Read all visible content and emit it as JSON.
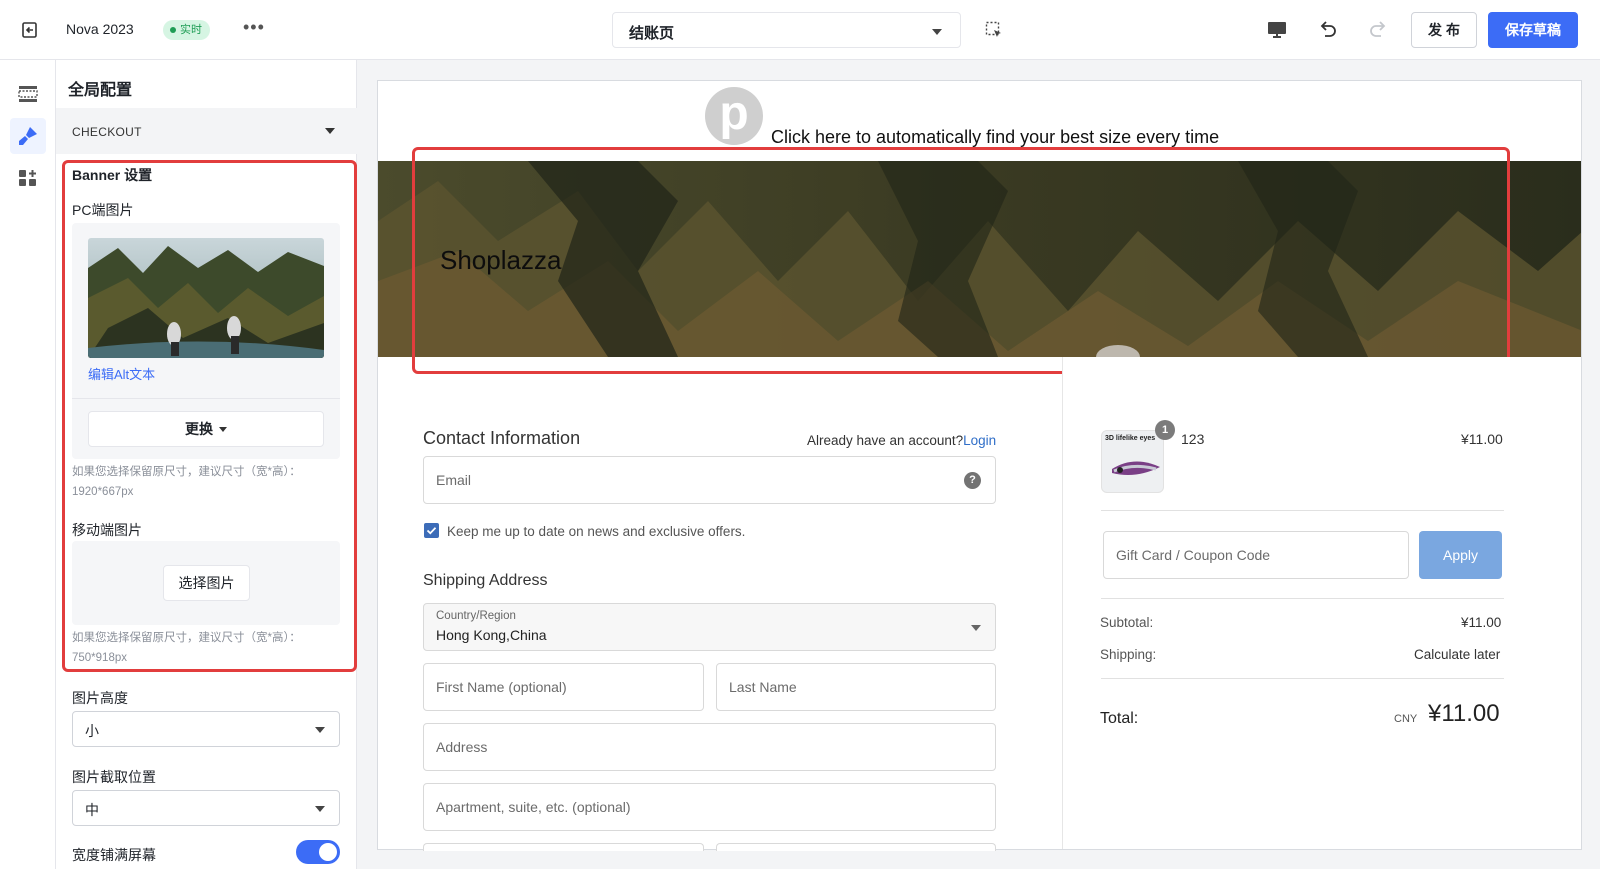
{
  "topbar": {
    "app_name": "Nova 2023",
    "live_badge": "实时",
    "more": "•••",
    "page_selector": "结账页",
    "publish": "发布",
    "save_draft": "保存草稿"
  },
  "panel": {
    "title": "全局配置",
    "section": "CHECKOUT",
    "banner_settings": "Banner 设置",
    "pc_image_label": "PC端图片",
    "edit_alt": "编辑Alt文本",
    "change_button": "更换",
    "pc_hint": "如果您选择保留原尺寸，建议尺寸（宽*高）：1920*667px",
    "mobile_image_label": "移动端图片",
    "choose_image": "选择图片",
    "mobile_hint": "如果您选择保留原尺寸，建议尺寸（宽*高）：750*918px",
    "image_height_label": "图片高度",
    "image_height_value": "小",
    "crop_position_label": "图片截取位置",
    "crop_position_value": "中",
    "full_width_label": "宽度铺满屏幕",
    "full_width_enabled": true
  },
  "preview": {
    "announcement": "Click here to automatically find your best size every time",
    "logo_letter": "p",
    "banner_title": "Shoplazza",
    "contact_title": "Contact Information",
    "have_account": "Already have an account?",
    "login": "Login",
    "email_placeholder": "Email",
    "help_icon": "?",
    "newsletter": "Keep me up to date on news and exclusive offers.",
    "shipping_title": "Shipping Address",
    "country_label": "Country/Region",
    "country_value": "Hong Kong,China",
    "first_name": "First Name (optional)",
    "last_name": "Last Name",
    "address": "Address",
    "apartment": "Apartment, suite, etc. (optional)",
    "product_thumb_text": "3D lifelike eyes",
    "product_qty": "1",
    "product_name": "123",
    "product_price": "¥11.00",
    "coupon_placeholder": "Gift Card / Coupon Code",
    "apply": "Apply",
    "subtotal_label": "Subtotal:",
    "subtotal_value": "¥11.00",
    "shipping_label": "Shipping:",
    "shipping_value": "Calculate later",
    "total_label": "Total:",
    "currency": "CNY",
    "total_value": "¥11.00"
  },
  "colors": {
    "accent": "#3c6cf6",
    "highlight": "#e23d3d",
    "live_badge_bg": "#d6f5e3",
    "live_badge_text": "#1f9d55",
    "apply_button": "#7aa7e0"
  }
}
